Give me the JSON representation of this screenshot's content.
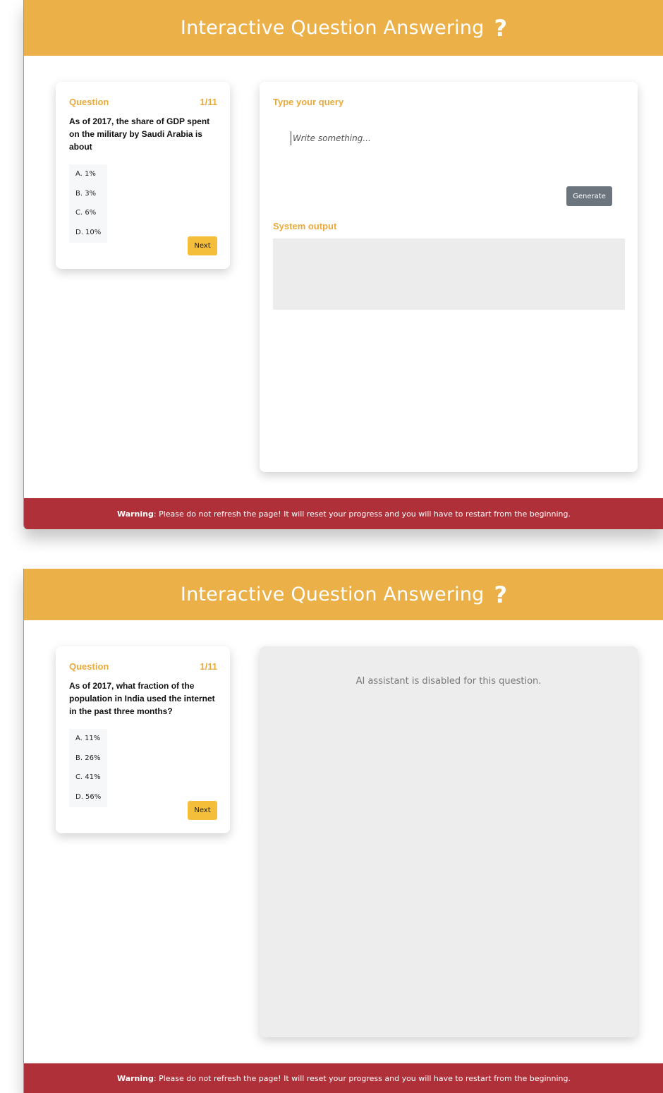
{
  "app": {
    "title": "Interactive Question Answering",
    "title_icon": "question-mark-icon",
    "accent_color": "#ebb048",
    "warning_color": "#b03039"
  },
  "panels": [
    {
      "question": {
        "label": "Question",
        "counter": "1/11",
        "text": "As of 2017, the share of GDP spent on the military by Saudi Arabia is about",
        "options": [
          "A. 1%",
          "B. 3%",
          "C. 6%",
          "D. 10%"
        ],
        "next_label": "Next"
      },
      "assistant": {
        "query_label": "Type your query",
        "query_value": "",
        "query_placeholder": "Write something...",
        "generate_label": "Generate",
        "output_label": "System output",
        "output_text": ""
      },
      "warning": {
        "label": "Warning",
        "text": ": Please do not refresh the page! It will reset your progress and you will have to restart from the beginning."
      }
    },
    {
      "question": {
        "label": "Question",
        "counter": "1/11",
        "text": "As of 2017, what fraction of the population in India used the internet in the past three months?",
        "options": [
          "A. 11%",
          "B. 26%",
          "C. 41%",
          "D. 56%"
        ],
        "next_label": "Next"
      },
      "assistant": {
        "disabled_text": "AI assistant is disabled for this question."
      },
      "warning": {
        "label": "Warning",
        "text": ": Please do not refresh the page! It will reset your progress and you will have to restart from the beginning."
      }
    }
  ]
}
